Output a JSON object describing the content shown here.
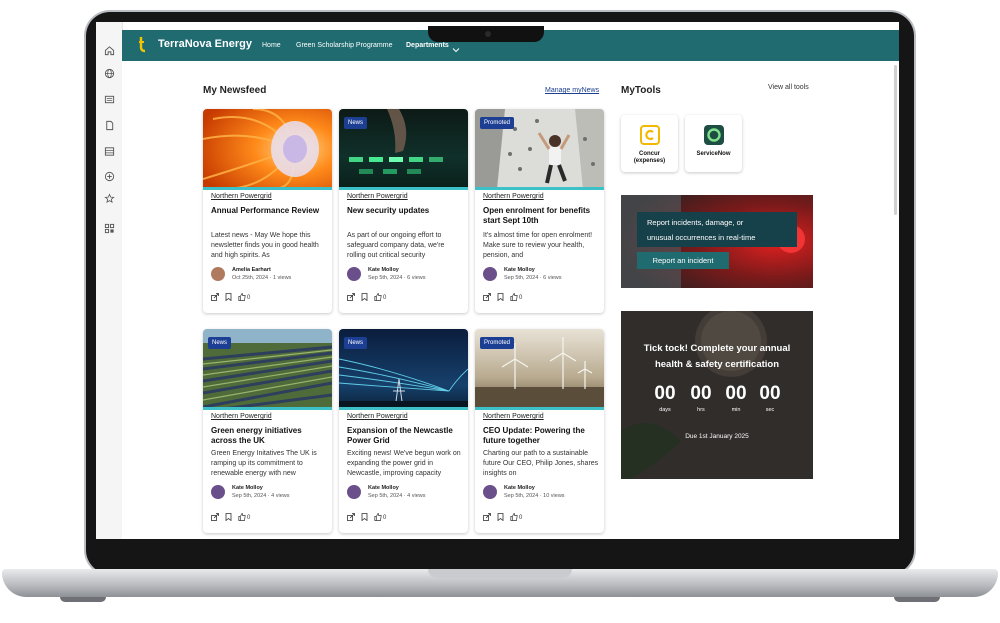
{
  "app": {
    "brand": "TerraNova Energy"
  },
  "nav": {
    "home": "Home",
    "scholarship": "Green Scholarship Programme",
    "departments": "Departments"
  },
  "newsfeed": {
    "title": "My Newsfeed",
    "manage": "Manage myNews"
  },
  "cards": [
    {
      "tag": "",
      "source": "Northern Powergrid",
      "title": "Annual Performance Review",
      "desc": "Latest news - May We hope this newsletter finds you in good health and high spirits. As",
      "author": "Amelia Earhart",
      "meta": "Oct 25th, 2024 · 1 views",
      "likes": "0"
    },
    {
      "tag": "News",
      "source": "Northern Powergrid",
      "title": "New security updates",
      "desc": "As part of our ongoing effort to safeguard company data, we're rolling out critical security",
      "author": "Kate Molloy",
      "meta": "Sep 5th, 2024 · 6 views",
      "likes": "0"
    },
    {
      "tag": "Promoted",
      "source": "Northern Powergrid",
      "title": "Open enrolment for benefits start Sept 10th",
      "desc": "It's almost time for open enrolment! Make sure to review your health, pension, and",
      "author": "Kate Molloy",
      "meta": "Sep 5th, 2024 · 6 views",
      "likes": "0"
    },
    {
      "tag": "News",
      "source": "Northern Powergrid",
      "title": "Green energy initiatives across the UK",
      "desc": "Green Energy Initatives The UK is ramping up its commitment to renewable energy with new",
      "author": "Kate Molloy",
      "meta": "Sep 5th, 2024 · 4 views",
      "likes": "0"
    },
    {
      "tag": "News",
      "source": "Northern Powergrid",
      "title": "Expansion of the Newcastle Power Grid",
      "desc": "Exciting news! We've begun work on expanding the power grid in Newcastle, improving capacity",
      "author": "Kate Molloy",
      "meta": "Sep 5th, 2024 · 4 views",
      "likes": "0"
    },
    {
      "tag": "Promoted",
      "source": "Northern Powergrid",
      "title": "CEO Update: Powering the future together",
      "desc": "Charting our path to a sustainable future Our CEO, Philip Jones, shares insights on",
      "author": "Kate Molloy",
      "meta": "Sep 5th, 2024 · 10 views",
      "likes": "0"
    }
  ],
  "tools": {
    "title": "MyTools",
    "view_all": "View all tools",
    "items": [
      {
        "label1": "Concur",
        "label2": "(expenses)",
        "color": "#f5b800"
      },
      {
        "label1": "ServiceNow",
        "label2": "",
        "color": "#1e4d44"
      }
    ]
  },
  "incident": {
    "text1": "Report incidents, damage, or",
    "text2": "unusual occurrences in real-time",
    "button": "Report an incident"
  },
  "countdown": {
    "heading1": "Tick tock! Complete your annual",
    "heading2": "health & safety certification",
    "days": "00",
    "hrs": "00",
    "min": "00",
    "sec": "00",
    "days_label": "days",
    "hrs_label": "hrs",
    "min_label": "min",
    "sec_label": "sec",
    "due": "Due 1st January 2025"
  },
  "colors": {
    "topbar": "#1f6b70",
    "tag": "#1c3f94",
    "stripe": "#3cc1c8"
  },
  "icons": {
    "rail": [
      "home-icon",
      "globe-icon",
      "news-icon",
      "document-icon",
      "list-icon",
      "add-icon",
      "star-icon",
      "apps-icon"
    ]
  }
}
